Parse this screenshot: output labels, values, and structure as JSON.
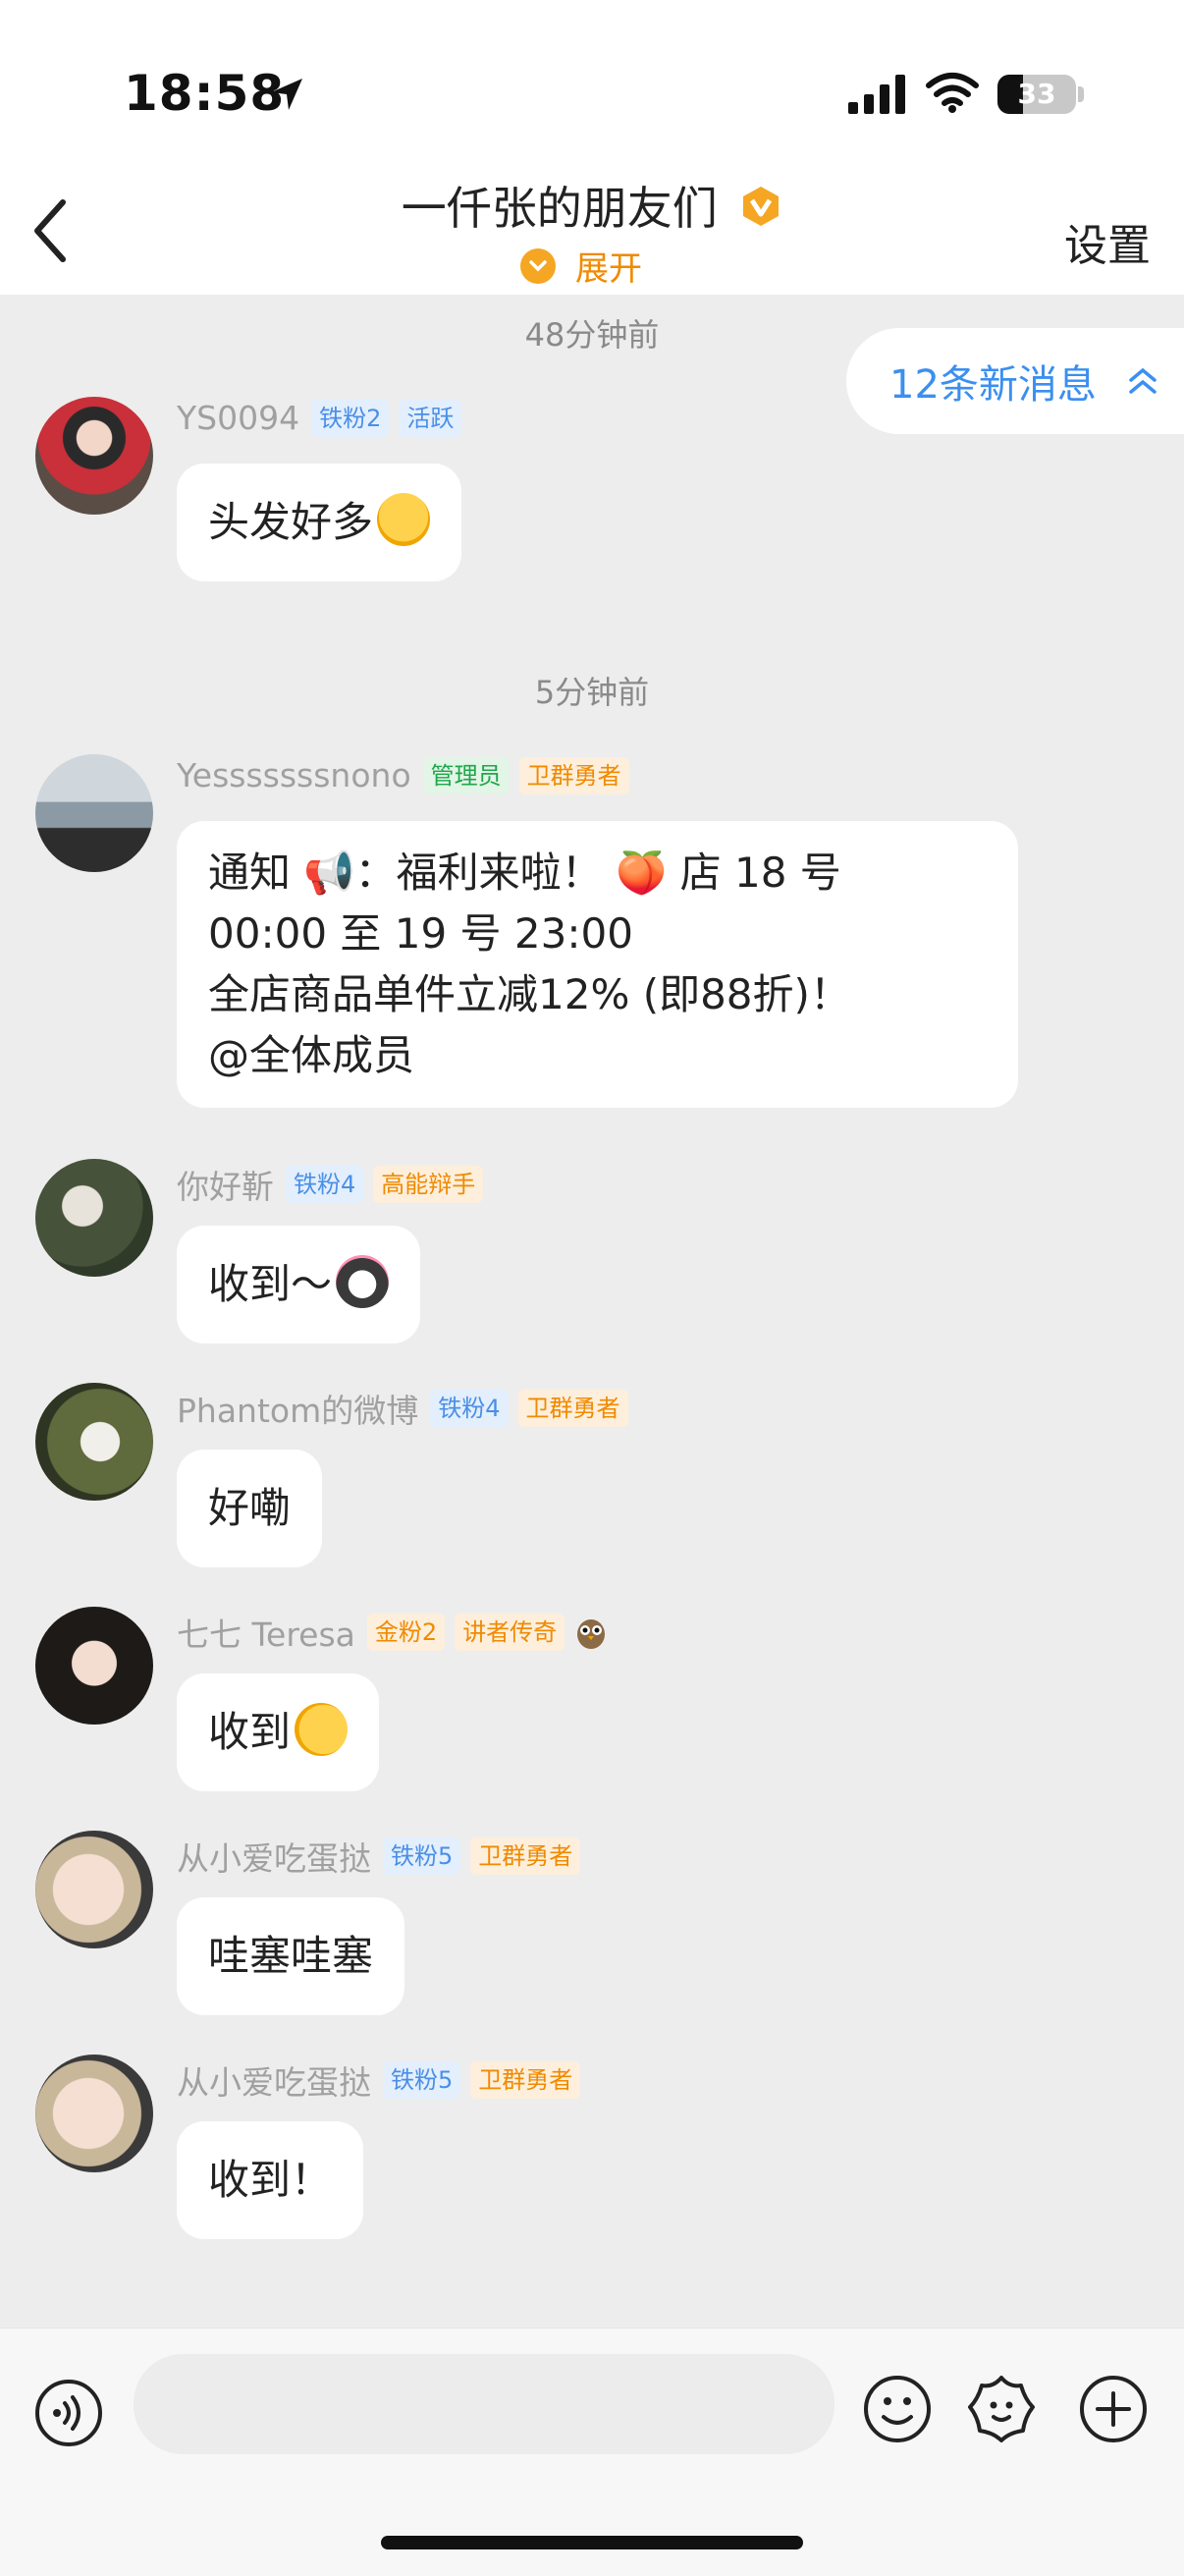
{
  "status_bar": {
    "time": "18:58",
    "battery": "33",
    "battery_level": 0.33,
    "icons": [
      "location-arrow-icon",
      "signal-icon",
      "wifi-icon",
      "battery-icon"
    ]
  },
  "header": {
    "back_icon": "chevron-left-icon",
    "title": "一仟张的朋友们",
    "title_badge_icon": "verified-v-badge-icon",
    "expand_label": "展开",
    "settings_label": "设置"
  },
  "new_messages": {
    "label": "12条新消息",
    "icon": "double-chevron-up-icon"
  },
  "timestamps": [
    "48分钟前",
    "5分钟前"
  ],
  "messages": [
    {
      "user": "YS0094",
      "tags": [
        "铁粉2",
        "活跃"
      ],
      "text": "头发好多",
      "emoji": "crying-face"
    },
    {
      "user": "Yesssssssnono",
      "tags": [
        "管理员",
        "卫群勇者"
      ],
      "lines": [
        "通知 📢：福利来啦！ 🍑 店 18 号",
        "00:00 至 19 号 23:00",
        "全店商品单件立减12% (即88折)！",
        "@全体成员"
      ]
    },
    {
      "user": "你好靳",
      "tags": [
        "铁粉4",
        "高能辩手"
      ],
      "text": "收到～",
      "emoji": "cat-heart"
    },
    {
      "user": "Phantom的微博",
      "tags": [
        "铁粉4",
        "卫群勇者"
      ],
      "text": "好嘞"
    },
    {
      "user": "七七 Teresa",
      "tags": [
        "金粉2",
        "讲者传奇"
      ],
      "extra_icon": "owl-icon",
      "text": "收到",
      "emoji": "pointing-face"
    },
    {
      "user": "从小爱吃蛋挞",
      "tags": [
        "铁粉5",
        "卫群勇者"
      ],
      "text": "哇塞哇塞"
    },
    {
      "user": "从小爱吃蛋挞",
      "tags": [
        "铁粉5",
        "卫群勇者"
      ],
      "text": "收到！"
    }
  ],
  "composer": {
    "icons": [
      "voice-icon",
      "emoji-icon",
      "sticker-icon",
      "plus-icon"
    ],
    "input_placeholder": ""
  },
  "colors": {
    "accent_blue": "#3b8ff0",
    "accent_orange": "#f08a00",
    "background": "#ededed"
  }
}
